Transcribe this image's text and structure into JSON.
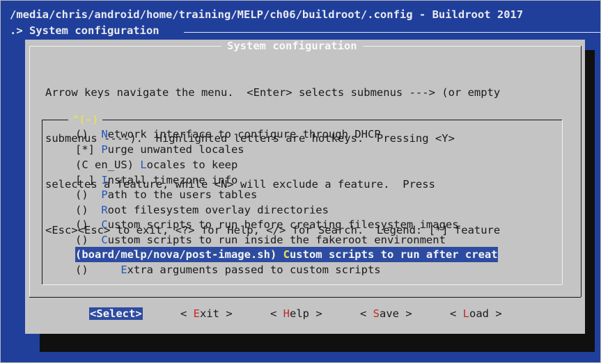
{
  "window": {
    "title": "/media/chris/android/home/training/MELP/ch06/buildroot/.config - Buildroot 2017",
    "breadcrumb": ".> System configuration"
  },
  "dialog": {
    "title": "System configuration",
    "help_lines": [
      "Arrow keys navigate the menu.  <Enter> selects submenus ---> (or empty",
      "submenus ----).  Highlighted letters are hotkeys.  Pressing <Y>",
      "selectes a feature, while <N> will exclude a feature.  Press",
      "<Esc><Esc> to exit, <?> for Help, </> for Search.  Legend: [*] feature"
    ],
    "scroll_indicator": "^(-)"
  },
  "menu": {
    "items": [
      {
        "prefix": "()  ",
        "hotkey": "N",
        "rest": "etwork interface to configure through DHCP"
      },
      {
        "prefix": "[*] ",
        "hotkey": "P",
        "rest": "urge unwanted locales"
      },
      {
        "prefix": "(C en_US) ",
        "hotkey": "L",
        "rest": "ocales to keep"
      },
      {
        "prefix": "[ ] ",
        "hotkey": "I",
        "rest": "nstall timezone info"
      },
      {
        "prefix": "()  ",
        "hotkey": "P",
        "rest": "ath to the users tables"
      },
      {
        "prefix": "()  ",
        "hotkey": "R",
        "rest": "oot filesystem overlay directories"
      },
      {
        "prefix": "()  ",
        "hotkey": "C",
        "rest": "ustom scripts to run before creating filesystem images"
      },
      {
        "prefix": "()  ",
        "hotkey": "C",
        "rest": "ustom scripts to run inside the fakeroot environment"
      },
      {
        "prefix": "(board/melp/nova/post-image.sh) ",
        "hotkey": "C",
        "rest": "ustom scripts to run after creat"
      },
      {
        "prefix": "()     ",
        "hotkey": "E",
        "rest": "xtra arguments passed to custom scripts"
      }
    ],
    "selected_index": 8
  },
  "buttons": [
    {
      "pre": "<",
      "hotkey": "S",
      "post": "elect>"
    },
    {
      "pre": "< ",
      "hotkey": "E",
      "post": "xit >"
    },
    {
      "pre": "< ",
      "hotkey": "H",
      "post": "elp >"
    },
    {
      "pre": "< ",
      "hotkey": "S",
      "post": "ave >"
    },
    {
      "pre": "< ",
      "hotkey": "L",
      "post": "oad >"
    }
  ],
  "colors": {
    "background": "#1f3f9b",
    "dialog": "#c4c4c4",
    "highlight": "#2d4ca1",
    "menu_hotkey": "#2456b8",
    "button_hotkey": "#c62828",
    "scroll_indicator": "#e2e25a"
  }
}
